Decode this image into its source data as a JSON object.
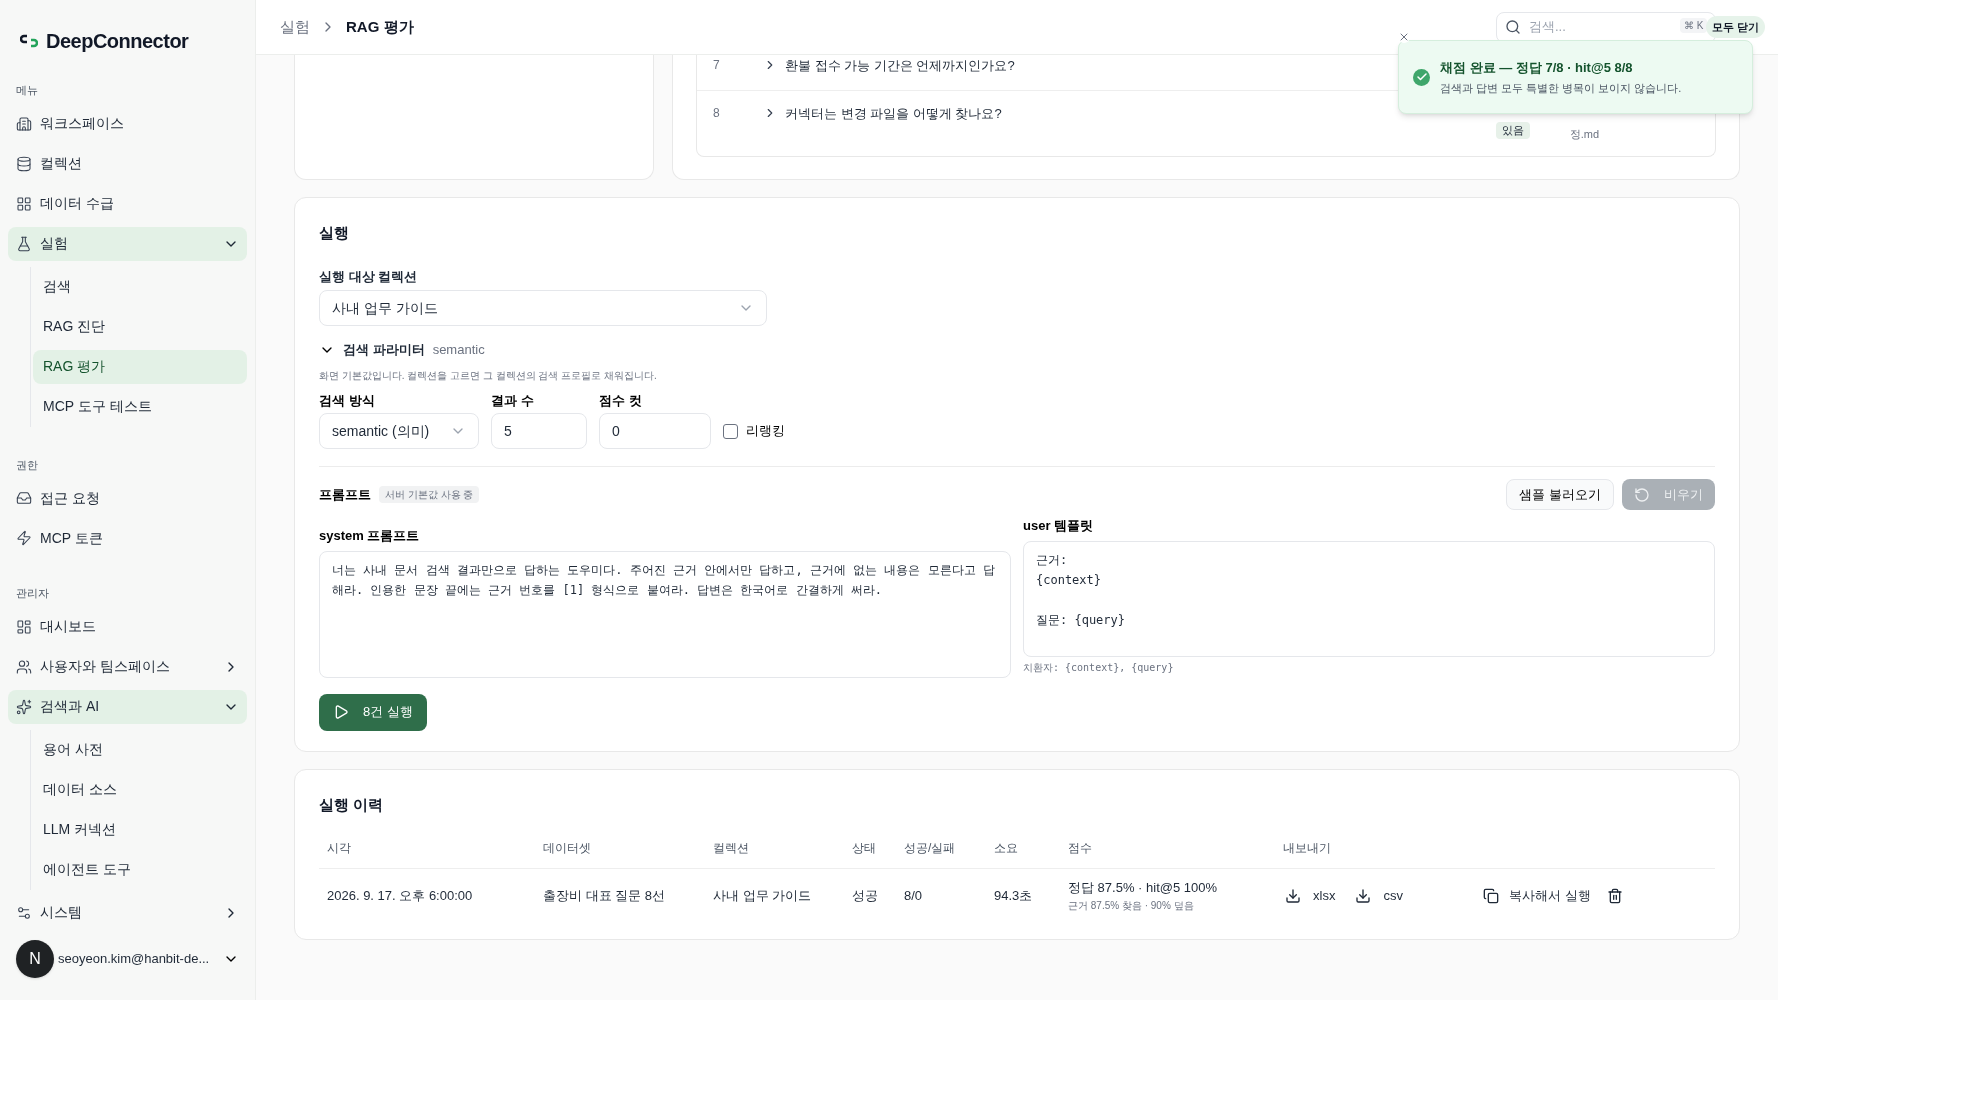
{
  "brand": "DeepConnector",
  "sidebar": {
    "sections": [
      {
        "title": "메뉴",
        "items": [
          {
            "label": "워크스페이스",
            "selected": false
          },
          {
            "label": "컬렉션",
            "selected": false
          },
          {
            "label": "데이터 수급",
            "selected": false
          },
          {
            "label": "실험",
            "selected": false,
            "expanded": true,
            "children": [
              {
                "label": "검색",
                "selected": false
              },
              {
                "label": "RAG 진단",
                "selected": false
              },
              {
                "label": "RAG 평가",
                "selected": true
              },
              {
                "label": "MCP 도구 테스트",
                "selected": false
              }
            ]
          }
        ]
      },
      {
        "title": "권한",
        "items": [
          {
            "label": "접근 요청",
            "selected": false
          },
          {
            "label": "MCP 토큰",
            "selected": false
          }
        ]
      },
      {
        "title": "관리자",
        "items": [
          {
            "label": "대시보드",
            "selected": false
          },
          {
            "label": "사용자와 팀스페이스",
            "selected": false,
            "expanded": false
          },
          {
            "label": "검색과 AI",
            "selected": false,
            "expanded": true,
            "children": [
              {
                "label": "용어 사전",
                "selected": false
              },
              {
                "label": "데이터 소스",
                "selected": false
              },
              {
                "label": "LLM 커넥션",
                "selected": false
              },
              {
                "label": "에이전트 도구",
                "selected": false
              }
            ]
          },
          {
            "label": "시스템",
            "selected": false,
            "expanded": false
          }
        ]
      }
    ],
    "user": {
      "avatar": "N",
      "email": "seoyeon.kim@hanbit-de..."
    }
  },
  "breadcrumb": [
    "실험",
    "RAG 평가"
  ],
  "search": {
    "placeholder": "검색...",
    "shortcut": "⌘ K"
  },
  "toast": {
    "close_all": "모두 닫기",
    "title": "채점 완료 — 정답 7/8 · hit@5 8/8",
    "message": "검색과 답변 모두 특별한 병목이 보이지 않습니다."
  },
  "questions": [
    {
      "number": "7",
      "question": "환불 접수 가능 기간은 언제까지인가요?"
    },
    {
      "number": "8",
      "question": "커넥터는 변경 파일을 어떻게 찾나요?",
      "badge": "있음",
      "source": "정.md"
    }
  ],
  "run": {
    "title": "실행",
    "collection_label": "실행 대상 컬렉션",
    "collection": "사내 업무 가이드",
    "params": {
      "title": "검색 파라미터",
      "mode_tag": "semantic",
      "expanded": true,
      "hint": "화면 기본값입니다. 컬렉션을 고르면 그 컬렉션의 검색 프로필로 채워집니다.",
      "method_label": "검색 방식",
      "method": "semantic (의미)",
      "count_label": "결과 수",
      "count": "5",
      "cut_label": "점수 컷",
      "cut": "0",
      "rerank_label": "리랭킹",
      "rerank": false
    },
    "prompt": {
      "title": "프롬프트",
      "badge": "서버 기본값 사용 중",
      "load_button": "샘플 불러오기",
      "clear_button": "비우기",
      "clear_disabled": true,
      "system_label": "system 프롬프트",
      "system": "너는 사내 문서 검색 결과만으로 답하는 도우미다. 주어진 근거 안에서만 답하고, 근거에 없는 내용은 모른다고 답해라. 인용한 문장 끝에는 근거 번호를 [1] 형식으로 붙여라. 답변은 한국어로 간결하게 써라.",
      "user_label": "user 템플릿",
      "user": "근거:\n{context}\n\n질문: {query}",
      "hint": "치환자: {context}, {query}"
    },
    "run_button": "8건 실행"
  },
  "history": {
    "title": "실행 이력",
    "columns": [
      "시각",
      "데이터셋",
      "컬렉션",
      "상태",
      "성공/실패",
      "소요",
      "점수",
      "내보내기"
    ],
    "rows": [
      {
        "time": "2026. 9. 17. 오후 6:00:00",
        "dataset": "출장비 대표 질문 8선",
        "collection": "사내 업무 가이드",
        "status": "성공",
        "result": "8/0",
        "duration": "94.3초",
        "score": "정답 87.5% · hit@5 100%",
        "score_detail": "근거 87.5% 찾음 · 90% 덮음",
        "exports": [
          "xlsx",
          "csv"
        ],
        "copy": "복사해서 실행"
      }
    ]
  }
}
